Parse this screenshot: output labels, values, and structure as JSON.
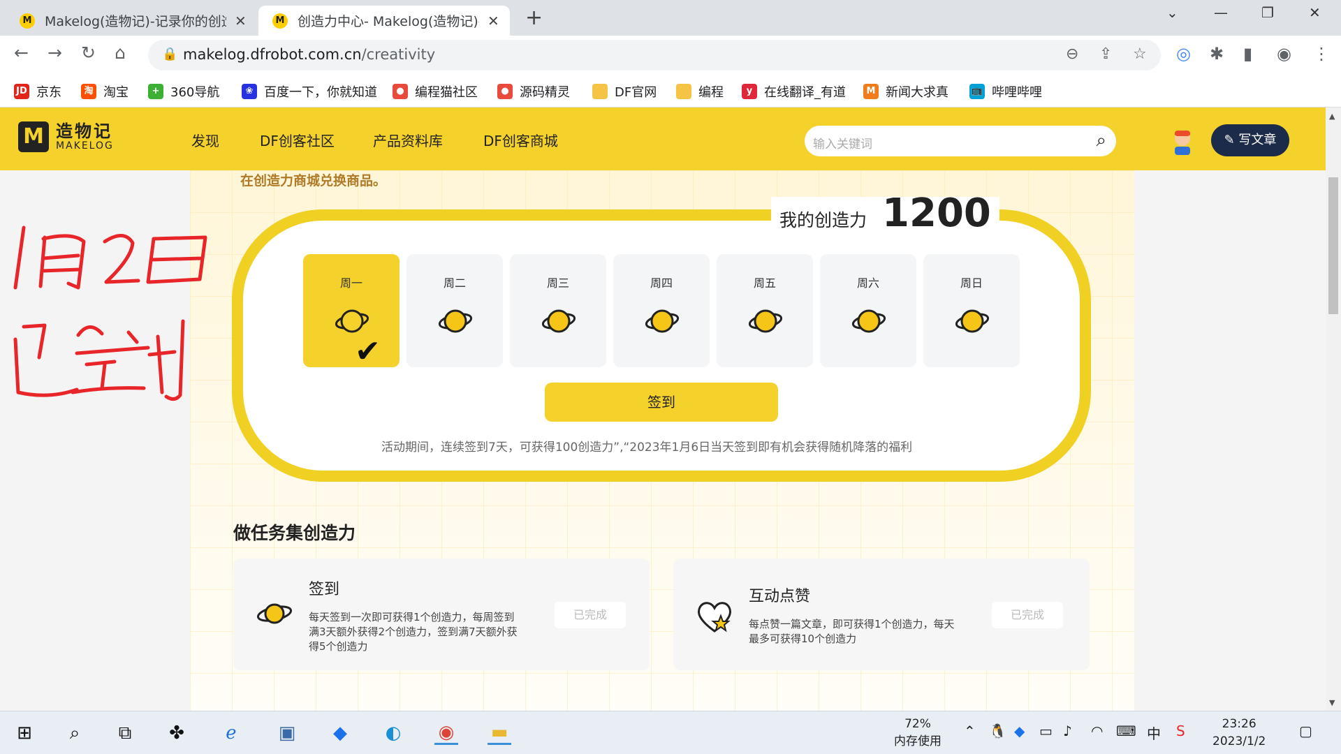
{
  "browser": {
    "tabs": [
      {
        "favicon": "M",
        "title": "Makelog(造物记)-记录你的创造"
      },
      {
        "favicon": "M",
        "title": "创造力中心- Makelog(造物记)-i"
      }
    ],
    "url_host": "makelog.dfrobot.com.cn",
    "url_path": "/creativity"
  },
  "bookmarks": [
    {
      "label": "京东",
      "icon": "JD",
      "color": "#e1251b"
    },
    {
      "label": "淘宝",
      "icon": "淘",
      "color": "#ff5000"
    },
    {
      "label": "360导航",
      "icon": "+",
      "color": "#3cb034"
    },
    {
      "label": "百度一下，你就知道",
      "icon": "❀",
      "color": "#2932e1"
    },
    {
      "label": "编程猫社区",
      "icon": "●",
      "color": "#e84b3c"
    },
    {
      "label": "源码精灵",
      "icon": "●",
      "color": "#e84b3c"
    },
    {
      "label": "DF官网",
      "icon": "",
      "color": "#f6c445"
    },
    {
      "label": "编程",
      "icon": "",
      "color": "#f6c445"
    },
    {
      "label": "在线翻译_有道",
      "icon": "y",
      "color": "#e0263b"
    },
    {
      "label": "新闻大求真",
      "icon": "M",
      "color": "#f07c1b"
    },
    {
      "label": "哔哩哔哩",
      "icon": "📺",
      "color": "#00a1d6"
    }
  ],
  "site": {
    "logo_cn": "造物记",
    "logo_en": "MAKELOG",
    "nav": [
      "发现",
      "DF创客社区",
      "产品资料库",
      "DF创客商城"
    ],
    "search_placeholder": "输入关键词",
    "write_button": "写文章"
  },
  "checkin": {
    "tip": "在创造力商城兑换商品。",
    "score_label": "我的创造力",
    "score": "1200",
    "days": [
      {
        "label": "周一",
        "checked": true
      },
      {
        "label": "周二",
        "checked": false
      },
      {
        "label": "周三",
        "checked": false
      },
      {
        "label": "周四",
        "checked": false
      },
      {
        "label": "周五",
        "checked": false
      },
      {
        "label": "周六",
        "checked": false
      },
      {
        "label": "周日",
        "checked": false
      }
    ],
    "button": "签到",
    "note": "活动期间，连续签到7天，可获得100创造力”,“2023年1月6日当天签到即有机会获得随机降落的福利"
  },
  "tasks": {
    "title": "做任务集创造力",
    "items": [
      {
        "title": "签到",
        "desc": "每天签到一次即可获得1个创造力，每周签到满3天额外获得2个创造力，签到满7天额外获得5个创造力",
        "status": "已完成",
        "icon": "planet-icon"
      },
      {
        "title": "互动点赞",
        "desc": "每点赞一篇文章，即可获得1个创造力，每天最多可获得10个创造力",
        "status": "已完成",
        "icon": "heart-star-icon"
      }
    ]
  },
  "annotation": {
    "line1": "1月2日",
    "line2": "已签到"
  },
  "taskbar": {
    "memory_pct": "72%",
    "memory_label": "内存使用",
    "ime": "中",
    "time": "23:26",
    "date": "2023/1/2"
  }
}
